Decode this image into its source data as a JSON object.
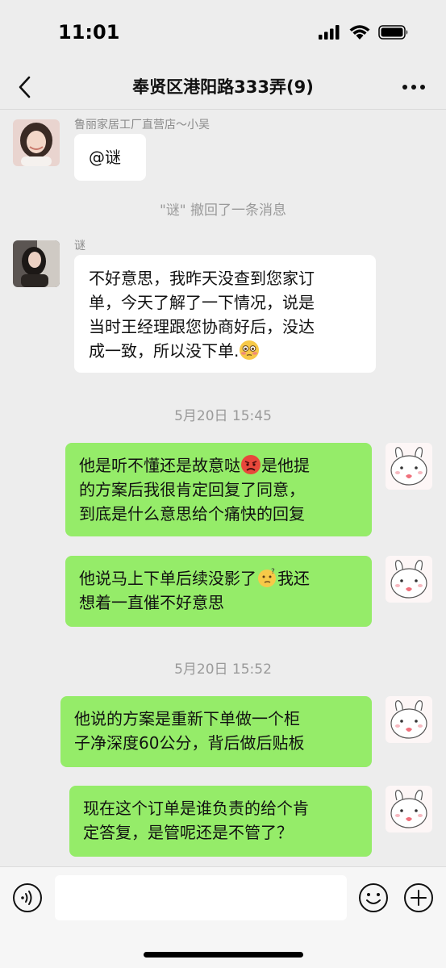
{
  "status_bar": {
    "time": "11:01"
  },
  "header": {
    "title": "奉贤区港阳路333弄(9)"
  },
  "messages": [
    {
      "sender": "鲁丽家居工厂直营店～小吴",
      "text": "@谜"
    },
    {
      "system": "\"谜\" 撤回了一条消息"
    },
    {
      "sender": "谜",
      "lines": [
        "不好意思，我昨天没查到您家订",
        "单，今天了解了一下情况，说是",
        "当时王经理跟您协商好后，没达",
        "成一致，所以没下单."
      ]
    },
    {
      "timestamp": "5月20日 15:45"
    },
    {
      "lines": [
        "他是听不懂还是故意哒",
        "是他提",
        "的方案后我很肯定回复了同意，",
        "到底是什么意思给个痛快的回复"
      ]
    },
    {
      "lines": [
        "他说马上下单后续没影了",
        "我还",
        "想着一直催不好意思"
      ]
    },
    {
      "timestamp": "5月20日 15:52"
    },
    {
      "lines": [
        "他说的方案是重新下单做一个柜",
        "子净深度60公分，背后做后贴板"
      ]
    },
    {
      "lines": [
        "现在这个订单是谁负责的给个肯",
        "定答复，是管呢还是不管了？"
      ]
    }
  ],
  "input": {
    "placeholder": ""
  },
  "icons": {
    "back": "chevron-left-icon",
    "more": "more-dots-icon",
    "voice": "voice-icon",
    "emoji": "emoji-icon",
    "plus": "plus-icon"
  },
  "colors": {
    "background": "#ededed",
    "self_bubble": "#95ec69",
    "other_bubble": "#ffffff"
  }
}
